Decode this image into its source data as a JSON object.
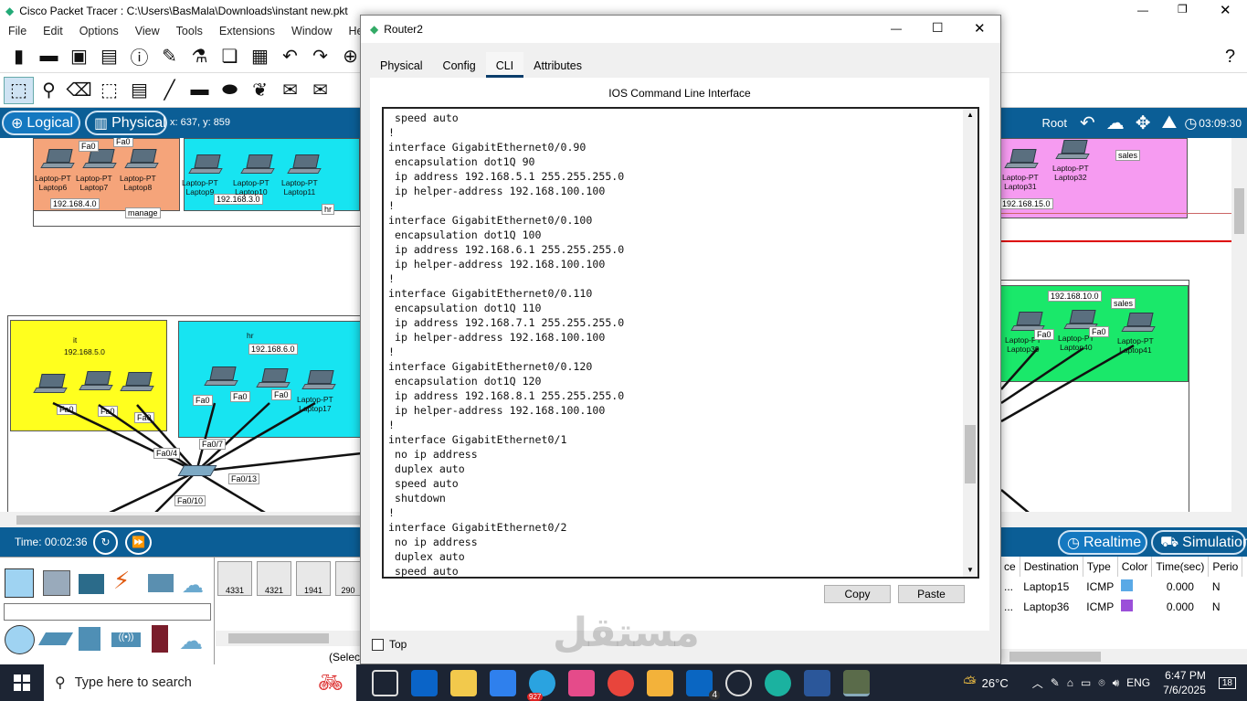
{
  "main_window": {
    "title": "Cisco Packet Tracer : C:\\Users\\BasMala\\Downloads\\instant new.pkt",
    "menu": [
      "File",
      "Edit",
      "Options",
      "View",
      "Tools",
      "Extensions",
      "Window",
      "Help"
    ],
    "logical_label": "Logical",
    "physical_label": "Physical",
    "coords": "x: 637, y: 859",
    "root_label": "Root",
    "clock": "03:09:30"
  },
  "workspace": {
    "areas": {
      "manage_net": "192.168.4.0",
      "manage_name": "manage",
      "hr_top_net": "192.168.3.0",
      "hr_top_name": "hr",
      "it_name": "it",
      "it_net": "192.168.5.0",
      "hr_mid_name": "hr",
      "hr_mid_net": "192.168.6.0",
      "sales_top_net": "192.168.15.0",
      "sales_top_name": "sales",
      "sales_mid_net": "192.168.10.0",
      "sales_mid_name": "sales"
    },
    "laptops": {
      "l6": "Laptop-PT\nLaptop6",
      "l7": "Laptop-PT\nLaptop7",
      "l8": "Laptop-PT\nLaptop8",
      "l9": "Laptop-PT\nLaptop9",
      "l10": "Laptop-PT\nLaptop10",
      "l11": "Laptop-PT\nLaptop11",
      "l31": "Laptop-PT\nLaptop31",
      "l32": "Laptop-PT\nLaptop32",
      "l39": "Laptop-PT\nLaptop39",
      "l40": "Laptop-PT\nLaptop40",
      "l41": "Laptop-PT\nLaptop41",
      "l17": "Laptop-PT\nLaptop17"
    },
    "ports": {
      "fa0": "Fa0",
      "fa04": "Fa0/4",
      "fa07": "Fa0/7",
      "fa013": "Fa0/13",
      "fa010": "Fa0/10"
    }
  },
  "bottom": {
    "time": "Time: 00:02:36",
    "realtime": "Realtime",
    "simulation": "Simulation",
    "device_models": [
      "4331",
      "4321",
      "1941",
      "290"
    ],
    "select": "(Selec",
    "events": {
      "headers": [
        "ce",
        "Destination",
        "Type",
        "Color",
        "Time(sec)",
        "Perio"
      ],
      "rows": [
        {
          "src": "...",
          "dest": "Laptop15",
          "type": "ICMP",
          "color": "#5aa9e6",
          "time": "0.000",
          "p": "N"
        },
        {
          "src": "...",
          "dest": "Laptop36",
          "type": "ICMP",
          "color": "#9b4fd9",
          "time": "0.000",
          "p": "N"
        }
      ]
    }
  },
  "dialog": {
    "title": "Router2",
    "tabs": [
      "Physical",
      "Config",
      "CLI",
      "Attributes"
    ],
    "active_tab": "CLI",
    "cli_title": "IOS Command Line Interface",
    "cli_lines": [
      " speed auto",
      "!",
      "interface GigabitEthernet0/0.90",
      " encapsulation dot1Q 90",
      " ip address 192.168.5.1 255.255.255.0",
      " ip helper-address 192.168.100.100",
      "!",
      "interface GigabitEthernet0/0.100",
      " encapsulation dot1Q 100",
      " ip address 192.168.6.1 255.255.255.0",
      " ip helper-address 192.168.100.100",
      "!",
      "interface GigabitEthernet0/0.110",
      " encapsulation dot1Q 110",
      " ip address 192.168.7.1 255.255.255.0",
      " ip helper-address 192.168.100.100",
      "!",
      "interface GigabitEthernet0/0.120",
      " encapsulation dot1Q 120",
      " ip address 192.168.8.1 255.255.255.0",
      " ip helper-address 192.168.100.100",
      "!",
      "interface GigabitEthernet0/1",
      " no ip address",
      " duplex auto",
      " speed auto",
      " shutdown",
      "!",
      "interface GigabitEthernet0/2",
      " no ip address",
      " duplex auto",
      " speed auto"
    ],
    "copy_label": "Copy",
    "paste_label": "Paste",
    "top_label": "Top"
  },
  "taskbar": {
    "search_placeholder": "Type here to search",
    "weather": "26°C",
    "lang": "ENG",
    "time": "6:47 PM",
    "date": "7/6/2025",
    "notif": "18",
    "badge_telegram": "927",
    "badge_in": "4"
  },
  "watermark": "مستقل"
}
